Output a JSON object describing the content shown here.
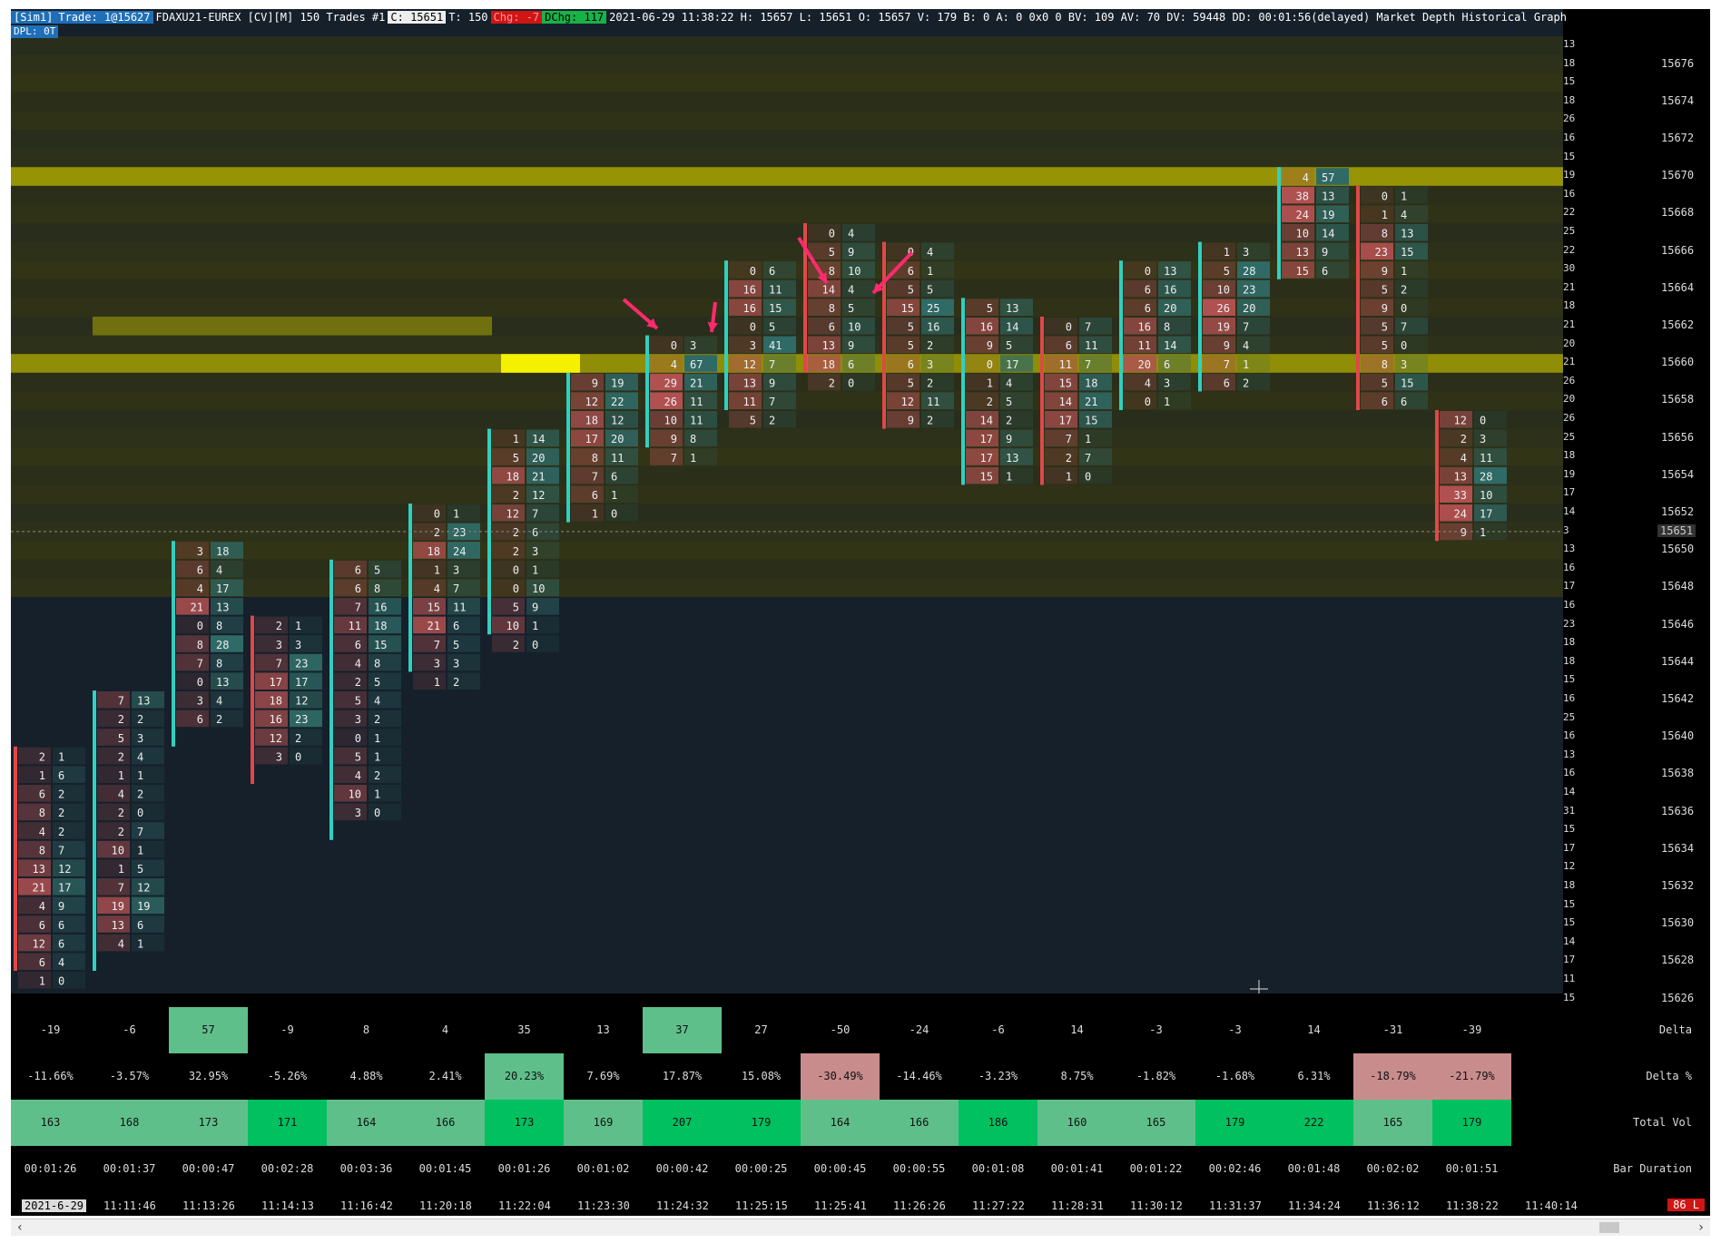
{
  "header": {
    "sim": "[Sim1]",
    "trade": "Trade: 1@15627",
    "symbol": "FDAXU21-EUREX [CV][M]  150 Trades  #1",
    "c_label": "C: 15651",
    "t_label": "T: 150",
    "chg_label": "Chg: -7",
    "dchg_label": "DChg: 117",
    "rest": "2021-06-29 11:38:22 H: 15657 L: 15651 O: 15657 V: 179 B: 0 A: 0 0x0 0 BV: 109 AV: 70 DV: 59448 DD: 00:01:56(delayed) Market Depth Historical Graph  (#00FFFF, #008FBF)",
    "dpl": "DPL: 0T"
  },
  "price_axis": {
    "max": 15677,
    "min": 15625,
    "tick_labels": [
      "15676",
      "15674",
      "15672",
      "15670",
      "15668",
      "15666",
      "15664",
      "15662",
      "15660",
      "15658",
      "15656",
      "15654",
      "15652",
      "15650",
      "15648",
      "15646",
      "15644",
      "15642",
      "15640",
      "15638",
      "15636",
      "15634",
      "15632",
      "15630",
      "15628",
      "15626"
    ],
    "current_price": "15651",
    "depth_sizes": [
      "13",
      "18",
      "15",
      "18",
      "26",
      "16",
      "15",
      "19",
      "16",
      "22",
      "25",
      "22",
      "30",
      "21",
      "18",
      "21",
      "20",
      "21",
      "26",
      "20",
      "26",
      "25",
      "18",
      "19",
      "17",
      "14",
      "3",
      "13",
      "16",
      "17",
      "16",
      "23",
      "18",
      "18",
      "15",
      "16",
      "25",
      "16",
      "13",
      "16",
      "14",
      "31",
      "15",
      "17",
      "12",
      "18",
      "15",
      "15",
      "14",
      "17",
      "11",
      "15"
    ]
  },
  "colors": {
    "heat_dark": "#16202b",
    "heat_mid": "#3a3a10",
    "heat_hi": "#b8b400",
    "heat_max": "#f5f000",
    "bid_cell": "#b05050",
    "ask_cell": "#2f6a66",
    "up_bar": "#30d0c0",
    "down_bar": "#e04848",
    "arrow": "#ff2a6d",
    "delta_pos": "#5fbf8a",
    "delta_neg": "#c98c8c",
    "vol_hi": "#00c060",
    "vol_mid": "#5fbf8a"
  },
  "chart_data": {
    "type": "footprint",
    "bars": [
      {
        "time": "11:11:46",
        "high": 15639,
        "low": 15628,
        "up": false,
        "cells": [
          [
            "2",
            "1"
          ],
          [
            "1",
            "6"
          ],
          [
            "6",
            "2"
          ],
          [
            "8",
            "2"
          ],
          [
            "4",
            "2"
          ],
          [
            "8",
            "7"
          ],
          [
            "13",
            "12"
          ],
          [
            "21",
            "17"
          ],
          [
            "4",
            "9"
          ],
          [
            "6",
            "6"
          ],
          [
            "12",
            "6"
          ],
          [
            "6",
            "4"
          ],
          [
            "1",
            "0"
          ]
        ]
      },
      {
        "time": "11:13:26",
        "high": 15642,
        "low": 15628,
        "up": true,
        "cells": [
          [
            "7",
            "13"
          ],
          [
            "2",
            "2"
          ],
          [
            "5",
            "3"
          ],
          [
            "2",
            "4"
          ],
          [
            "1",
            "1"
          ],
          [
            "4",
            "2"
          ],
          [
            "2",
            "0"
          ],
          [
            "2",
            "7"
          ],
          [
            "10",
            "1"
          ],
          [
            "1",
            "5"
          ],
          [
            "7",
            "12"
          ],
          [
            "19",
            "19"
          ],
          [
            "13",
            "6"
          ],
          [
            "4",
            "1"
          ]
        ]
      },
      {
        "time": "11:14:13",
        "high": 15650,
        "low": 15640,
        "up": true,
        "cells": [
          [
            "3",
            "18"
          ],
          [
            "6",
            "4"
          ],
          [
            "4",
            "17"
          ],
          [
            "21",
            "13"
          ],
          [
            "0",
            "8"
          ],
          [
            "8",
            "28"
          ],
          [
            "7",
            "8"
          ],
          [
            "0",
            "13"
          ],
          [
            "3",
            "4"
          ],
          [
            "6",
            "2"
          ]
        ]
      },
      {
        "time": "11:16:42",
        "high": 15646,
        "low": 15638,
        "up": false,
        "cells": [
          [
            "2",
            "1"
          ],
          [
            "3",
            "3"
          ],
          [
            "7",
            "23"
          ],
          [
            "17",
            "17"
          ],
          [
            "18",
            "12"
          ],
          [
            "16",
            "23"
          ],
          [
            "12",
            "2"
          ],
          [
            "3",
            "0"
          ]
        ]
      },
      {
        "time": "11:20:18",
        "high": 15649,
        "low": 15635,
        "up": true,
        "cells": [
          [
            "6",
            "5"
          ],
          [
            "6",
            "8"
          ],
          [
            "7",
            "16"
          ],
          [
            "11",
            "18"
          ],
          [
            "6",
            "15"
          ],
          [
            "4",
            "8"
          ],
          [
            "2",
            "5"
          ],
          [
            "5",
            "4"
          ],
          [
            "3",
            "2"
          ],
          [
            "0",
            "1"
          ],
          [
            "5",
            "1"
          ],
          [
            "4",
            "2"
          ],
          [
            "10",
            "1"
          ],
          [
            "3",
            "0"
          ]
        ]
      },
      {
        "time": "11:22:04",
        "high": 15652,
        "low": 15644,
        "up": true,
        "cells": [
          [
            "0",
            "1"
          ],
          [
            "2",
            "23"
          ],
          [
            "18",
            "24"
          ],
          [
            "1",
            "3"
          ],
          [
            "4",
            "7"
          ],
          [
            "15",
            "11"
          ],
          [
            "21",
            "6"
          ],
          [
            "7",
            "5"
          ],
          [
            "3",
            "3"
          ],
          [
            "1",
            "2"
          ]
        ]
      },
      {
        "time": "11:23:30",
        "high": 15656,
        "low": 15646,
        "up": true,
        "cells": [
          [
            "1",
            "14"
          ],
          [
            "5",
            "20"
          ],
          [
            "18",
            "21"
          ],
          [
            "2",
            "12"
          ],
          [
            "12",
            "7"
          ],
          [
            "2",
            "6"
          ],
          [
            "2",
            "3"
          ],
          [
            "0",
            "1"
          ],
          [
            "0",
            "10"
          ],
          [
            "5",
            "9"
          ],
          [
            "10",
            "1"
          ],
          [
            "2",
            "0"
          ]
        ]
      },
      {
        "time": "11:24:32",
        "high": 15659,
        "low": 15652,
        "up": true,
        "cells": [
          [
            "9",
            "19"
          ],
          [
            "12",
            "22"
          ],
          [
            "18",
            "12"
          ],
          [
            "17",
            "20"
          ],
          [
            "8",
            "11"
          ],
          [
            "7",
            "6"
          ],
          [
            "6",
            "1"
          ],
          [
            "1",
            "0"
          ]
        ]
      },
      {
        "time": "11:25:15",
        "high": 15661,
        "low": 15656,
        "up": true,
        "cells": [
          [
            "0",
            "3"
          ],
          [
            "4",
            "67"
          ],
          [
            "29",
            "21"
          ],
          [
            "26",
            "11"
          ],
          [
            "10",
            "11"
          ],
          [
            "9",
            "8"
          ],
          [
            "7",
            "1"
          ]
        ]
      },
      {
        "time": "11:25:41",
        "high": 15665,
        "low": 15658,
        "up": true,
        "cells": [
          [
            "0",
            "6"
          ],
          [
            "16",
            "11"
          ],
          [
            "16",
            "15"
          ],
          [
            "0",
            "5"
          ],
          [
            "3",
            "41"
          ],
          [
            "12",
            "7"
          ],
          [
            "13",
            "9"
          ],
          [
            "11",
            "7"
          ],
          [
            "5",
            "2"
          ]
        ]
      },
      {
        "time": "11:26:26",
        "high": 15667,
        "low": 15660,
        "up": false,
        "cells": [
          [
            "0",
            "4"
          ],
          [
            "5",
            "9"
          ],
          [
            "8",
            "10"
          ],
          [
            "14",
            "4"
          ],
          [
            "8",
            "5"
          ],
          [
            "6",
            "10"
          ],
          [
            "13",
            "9"
          ],
          [
            "18",
            "6"
          ],
          [
            "2",
            "0"
          ]
        ]
      },
      {
        "time": "11:27:22",
        "high": 15666,
        "low": 15657,
        "up": false,
        "cells": [
          [
            "0",
            "4"
          ],
          [
            "6",
            "1"
          ],
          [
            "5",
            "5"
          ],
          [
            "15",
            "25"
          ],
          [
            "5",
            "16"
          ],
          [
            "5",
            "2"
          ],
          [
            "6",
            "3"
          ],
          [
            "5",
            "2"
          ],
          [
            "12",
            "11"
          ],
          [
            "9",
            "2"
          ]
        ]
      },
      {
        "time": "11:28:31",
        "high": 15663,
        "low": 15654,
        "up": true,
        "cells": [
          [
            "5",
            "13"
          ],
          [
            "16",
            "14"
          ],
          [
            "9",
            "5"
          ],
          [
            "0",
            "17"
          ],
          [
            "1",
            "4"
          ],
          [
            "2",
            "5"
          ],
          [
            "14",
            "2"
          ],
          [
            "17",
            "9"
          ],
          [
            "17",
            "13"
          ],
          [
            "15",
            "1"
          ]
        ]
      },
      {
        "time": "11:30:12",
        "high": 15662,
        "low": 15654,
        "up": false,
        "cells": [
          [
            "0",
            "7"
          ],
          [
            "6",
            "11"
          ],
          [
            "11",
            "7"
          ],
          [
            "15",
            "18"
          ],
          [
            "14",
            "21"
          ],
          [
            "17",
            "15"
          ],
          [
            "7",
            "1"
          ],
          [
            "2",
            "7"
          ],
          [
            "1",
            "0"
          ]
        ]
      },
      {
        "time": "11:31:37",
        "high": 15665,
        "low": 15658,
        "up": true,
        "cells": [
          [
            "0",
            "13"
          ],
          [
            "6",
            "16"
          ],
          [
            "6",
            "20"
          ],
          [
            "16",
            "8"
          ],
          [
            "11",
            "14"
          ],
          [
            "20",
            "6"
          ],
          [
            "4",
            "3"
          ],
          [
            "0",
            "1"
          ]
        ]
      },
      {
        "time": "11:34:24",
        "high": 15666,
        "low": 15659,
        "up": true,
        "cells": [
          [
            "1",
            "3"
          ],
          [
            "5",
            "28"
          ],
          [
            "10",
            "23"
          ],
          [
            "26",
            "20"
          ],
          [
            "19",
            "7"
          ],
          [
            "9",
            "4"
          ],
          [
            "7",
            "1"
          ],
          [
            "6",
            "2"
          ]
        ]
      },
      {
        "time": "11:36:12",
        "high": 15670,
        "low": 15665,
        "up": true,
        "cells": [
          [
            "4",
            "57"
          ],
          [
            "38",
            "13"
          ],
          [
            "24",
            "19"
          ],
          [
            "10",
            "14"
          ],
          [
            "13",
            "9"
          ],
          [
            "15",
            "6"
          ]
        ]
      },
      {
        "time": "11:38:22",
        "high": 15669,
        "low": 15658,
        "up": false,
        "cells": [
          [
            "0",
            "1"
          ],
          [
            "1",
            "4"
          ],
          [
            "8",
            "13"
          ],
          [
            "23",
            "15"
          ],
          [
            "9",
            "1"
          ],
          [
            "5",
            "2"
          ],
          [
            "9",
            "0"
          ],
          [
            "5",
            "7"
          ],
          [
            "5",
            "0"
          ],
          [
            "8",
            "3"
          ],
          [
            "5",
            "15"
          ],
          [
            "6",
            "6"
          ]
        ]
      },
      {
        "time": "11:40:14",
        "high": 15657,
        "low": 15651,
        "up": false,
        "cells": [
          [
            "12",
            "0"
          ],
          [
            "2",
            "3"
          ],
          [
            "4",
            "11"
          ],
          [
            "13",
            "28"
          ],
          [
            "33",
            "10"
          ],
          [
            "24",
            "17"
          ],
          [
            "9",
            "1"
          ]
        ]
      }
    ]
  },
  "stats": {
    "labels": {
      "delta": "Delta",
      "delta_pct": "Delta %",
      "total_vol": "Total Vol",
      "duration": "Bar Duration"
    },
    "delta": [
      "-19",
      "-6",
      "57",
      "-9",
      "8",
      "4",
      "35",
      "13",
      "37",
      "27",
      "-50",
      "-24",
      "-6",
      "14",
      "-3",
      "-3",
      "14",
      "-31",
      "-39"
    ],
    "delta_hl": [
      "",
      "",
      "pos",
      "",
      "",
      "",
      "",
      "",
      "pos",
      "",
      "",
      "",
      "",
      "",
      "",
      "",
      "",
      "",
      ""
    ],
    "delta_pct": [
      "-11.66%",
      "-3.57%",
      "32.95%",
      "-5.26%",
      "4.88%",
      "2.41%",
      "20.23%",
      "7.69%",
      "17.87%",
      "15.08%",
      "-30.49%",
      "-14.46%",
      "-3.23%",
      "8.75%",
      "-1.82%",
      "-1.68%",
      "6.31%",
      "-18.79%",
      "-21.79%"
    ],
    "delta_pct_hl": [
      "",
      "",
      "",
      "",
      "",
      "",
      "pos",
      "",
      "",
      "",
      "neg",
      "",
      "",
      "",
      "",
      "",
      "",
      "neg",
      "neg"
    ],
    "total_vol": [
      "163",
      "168",
      "173",
      "171",
      "164",
      "166",
      "173",
      "169",
      "207",
      "179",
      "164",
      "166",
      "186",
      "160",
      "165",
      "179",
      "222",
      "165",
      "179"
    ],
    "total_vol_hl": [
      "mid",
      "mid",
      "mid",
      "hi",
      "mid",
      "mid",
      "hi",
      "mid",
      "hi",
      "hi",
      "mid",
      "mid",
      "hi",
      "mid",
      "mid",
      "hi",
      "hi",
      "mid",
      "hi"
    ],
    "duration": [
      "00:01:26",
      "00:01:37",
      "00:00:47",
      "00:02:28",
      "00:03:36",
      "00:01:45",
      "00:01:26",
      "00:01:02",
      "00:00:42",
      "00:00:25",
      "00:00:45",
      "00:00:55",
      "00:01:08",
      "00:01:41",
      "00:01:22",
      "00:02:46",
      "00:01:48",
      "00:02:02",
      "00:01:51"
    ]
  },
  "time_axis": {
    "date": "2021-6-29",
    "labels": [
      "11:11:46",
      "11:13:26",
      "11:14:13",
      "11:16:42",
      "11:20:18",
      "11:22:04",
      "11:23:30",
      "11:24:32",
      "11:25:15",
      "11:25:41",
      "11:26:26",
      "11:27:22",
      "11:28:31",
      "11:30:12",
      "11:31:37",
      "11:34:24",
      "11:36:12",
      "11:38:22",
      "11:40:14"
    ]
  },
  "status": {
    "latency": "86 L"
  }
}
